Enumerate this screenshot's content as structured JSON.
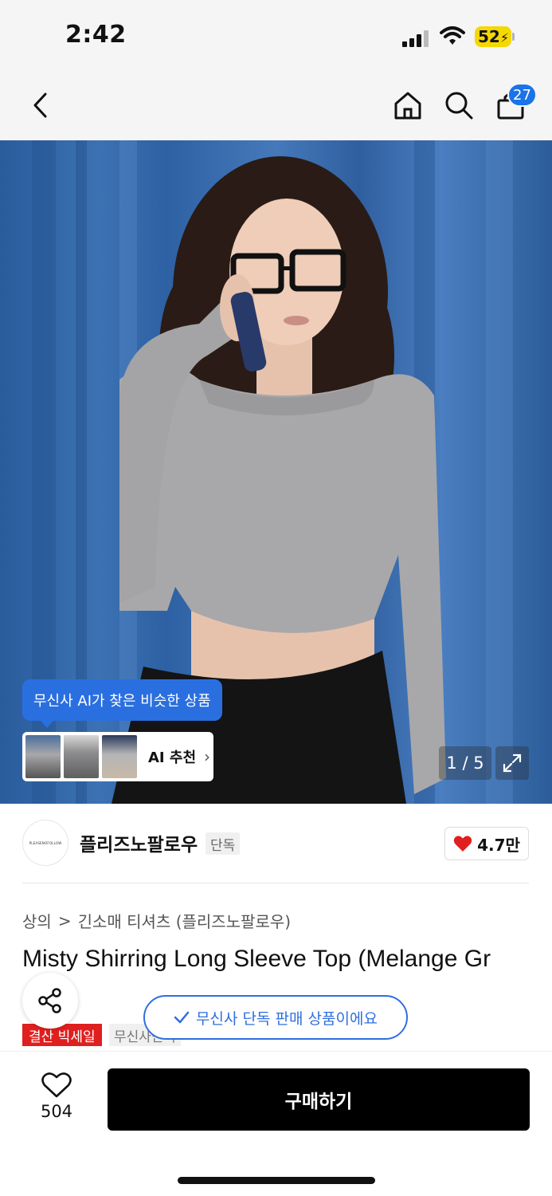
{
  "status_bar": {
    "time": "2:42",
    "battery_percent": "52"
  },
  "header": {
    "back_icon": "chevron-left-icon",
    "home_icon": "home-icon",
    "search_icon": "search-icon",
    "cart_icon": "shopping-bag-icon",
    "cart_count": "27"
  },
  "gallery": {
    "ai_tooltip": "무신사 AI가 찾은 비슷한 상품",
    "ai_recommend_label": "AI 추천",
    "counter": "1 / 5",
    "current_index": 1,
    "total": 5
  },
  "brand": {
    "logo_text": "PLEASENOFOLLOW",
    "name": "플리즈노팔로우",
    "tag": "단독",
    "likes": "4.7만"
  },
  "breadcrumb": {
    "category": "상의",
    "separator": ">",
    "subcategory": "긴소매 티셔츠 (플리즈노팔로우)"
  },
  "product": {
    "title": "Misty Shirring Long Sleeve Top (Melange Gr",
    "exclusive_notice": "무신사 단독 판매 상품이에요",
    "badge_sale": "결산 빅세일",
    "badge_other": "무신사단독"
  },
  "bottom_bar": {
    "wish_count": "504",
    "buy_label": "구매하기"
  },
  "colors": {
    "accent_blue": "#2f6fe0",
    "sale_red": "#e01f1f",
    "buy_black": "#000000"
  }
}
